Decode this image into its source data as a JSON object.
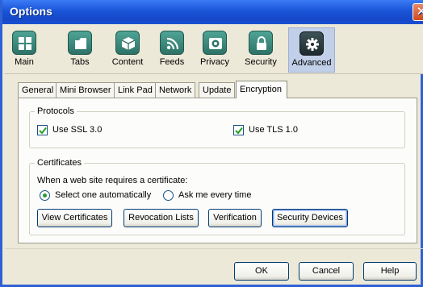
{
  "window": {
    "title": "Options",
    "close_glyph": "✕"
  },
  "toolbar": {
    "items": [
      {
        "label": "Main",
        "icon": "grid-icon"
      },
      {
        "label": "Tabs",
        "icon": "folder-tabs-icon"
      },
      {
        "label": "Content",
        "icon": "content-cube-icon"
      },
      {
        "label": "Feeds",
        "icon": "rss-feed-icon"
      },
      {
        "label": "Privacy",
        "icon": "privacy-eye-icon"
      },
      {
        "label": "Security",
        "icon": "padlock-icon"
      },
      {
        "label": "Advanced",
        "icon": "gear-icon"
      }
    ],
    "selected": "Advanced"
  },
  "tabs": {
    "items": [
      "General",
      "Mini Browser",
      "Link Pad",
      "Network",
      "Update",
      "Encryption"
    ],
    "selected": "Encryption"
  },
  "protocols": {
    "legend": "Protocols",
    "ssl_label": "Use SSL 3.0",
    "ssl_checked": true,
    "tls_label": "Use TLS 1.0",
    "tls_checked": true
  },
  "certificates": {
    "legend": "Certificates",
    "prompt": "When a web site requires a certificate:",
    "option_auto": "Select one automatically",
    "option_ask": "Ask me every time",
    "selected_option": "Select one automatically",
    "buttons": {
      "view": "View Certificates",
      "revocation": "Revocation Lists",
      "verification": "Verification",
      "security_devices": "Security Devices"
    }
  },
  "footer": {
    "ok": "OK",
    "cancel": "Cancel",
    "help": "Help"
  }
}
